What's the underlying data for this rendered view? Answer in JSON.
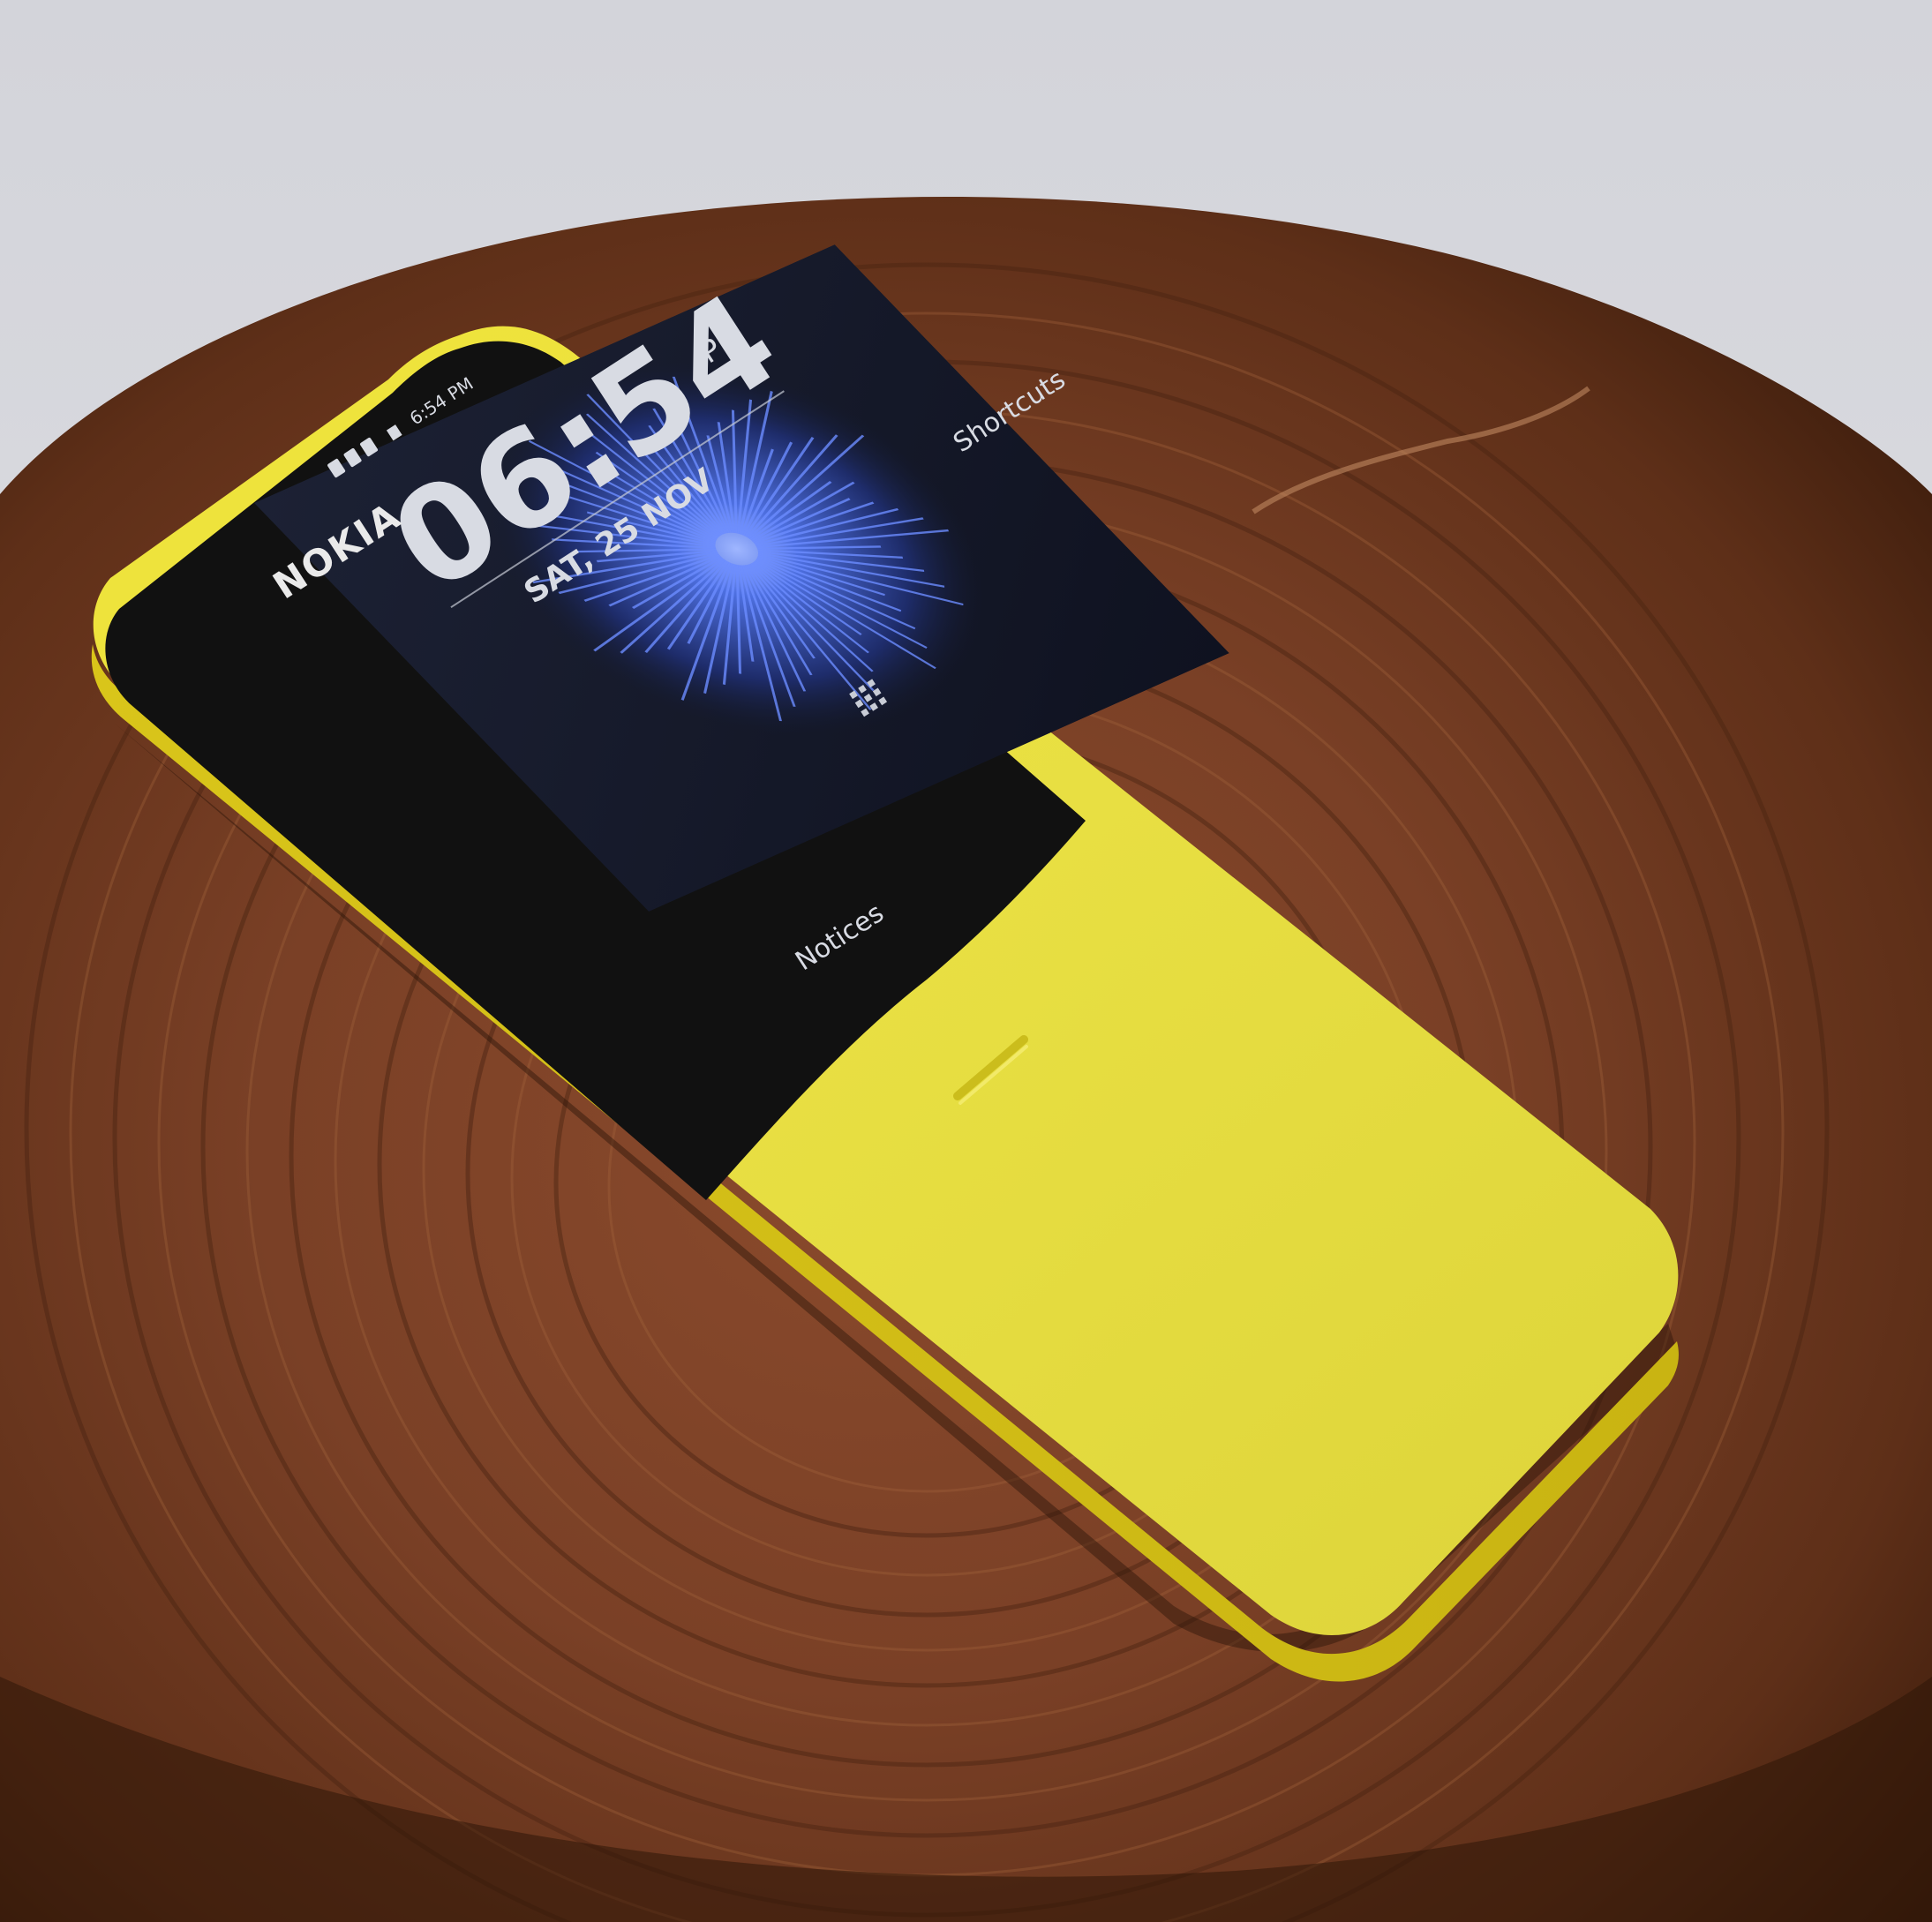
{
  "photo": {
    "subject": "yellow Nokia phone on wooden stump",
    "colors": {
      "backdrop": "#d8d9de",
      "wood_dark": "#3f2010",
      "wood_mid": "#7a4228",
      "wood_light": "#9c5a38",
      "phone_yellow": "#e6df3c",
      "phone_yellow_shade": "#d4c21e",
      "bezel": "#121212",
      "screen_bg": "#14182a",
      "wallpaper_burst": "#4c6ad8"
    }
  },
  "phone": {
    "brand": "NOKIA",
    "status_bar": {
      "time": "6:54 PM"
    },
    "lock_screen": {
      "clock": "06:54",
      "ampm": "PM",
      "date": "SAT, 25 NOV",
      "left_softkey": "Notices",
      "right_softkey": "Shortcuts",
      "center_icon": "keypad-grid-icon"
    }
  }
}
